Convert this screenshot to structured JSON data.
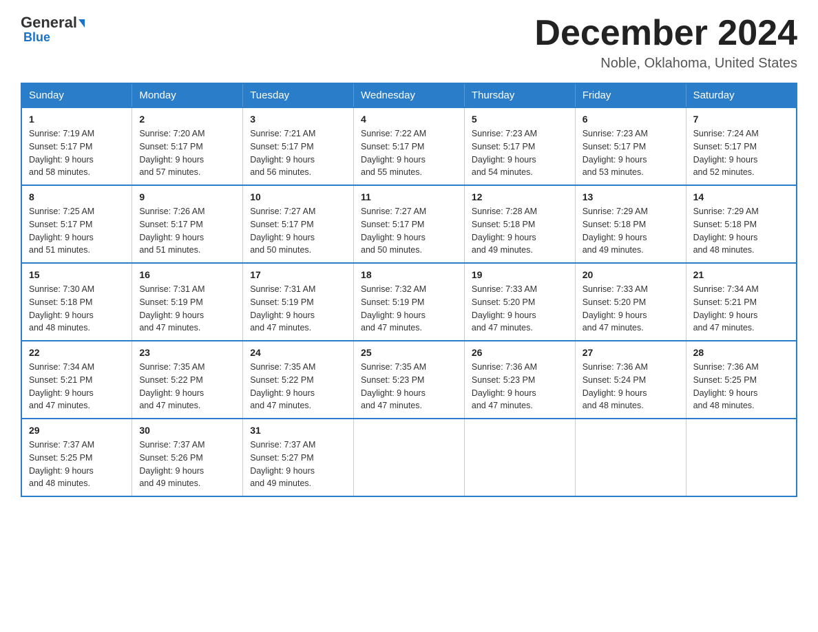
{
  "logo": {
    "general": "General",
    "arrow": "▶",
    "blue": "Blue"
  },
  "header": {
    "title": "December 2024",
    "subtitle": "Noble, Oklahoma, United States"
  },
  "weekdays": [
    "Sunday",
    "Monday",
    "Tuesday",
    "Wednesday",
    "Thursday",
    "Friday",
    "Saturday"
  ],
  "weeks": [
    [
      {
        "day": "1",
        "sunrise": "7:19 AM",
        "sunset": "5:17 PM",
        "daylight": "9 hours and 58 minutes."
      },
      {
        "day": "2",
        "sunrise": "7:20 AM",
        "sunset": "5:17 PM",
        "daylight": "9 hours and 57 minutes."
      },
      {
        "day": "3",
        "sunrise": "7:21 AM",
        "sunset": "5:17 PM",
        "daylight": "9 hours and 56 minutes."
      },
      {
        "day": "4",
        "sunrise": "7:22 AM",
        "sunset": "5:17 PM",
        "daylight": "9 hours and 55 minutes."
      },
      {
        "day": "5",
        "sunrise": "7:23 AM",
        "sunset": "5:17 PM",
        "daylight": "9 hours and 54 minutes."
      },
      {
        "day": "6",
        "sunrise": "7:23 AM",
        "sunset": "5:17 PM",
        "daylight": "9 hours and 53 minutes."
      },
      {
        "day": "7",
        "sunrise": "7:24 AM",
        "sunset": "5:17 PM",
        "daylight": "9 hours and 52 minutes."
      }
    ],
    [
      {
        "day": "8",
        "sunrise": "7:25 AM",
        "sunset": "5:17 PM",
        "daylight": "9 hours and 51 minutes."
      },
      {
        "day": "9",
        "sunrise": "7:26 AM",
        "sunset": "5:17 PM",
        "daylight": "9 hours and 51 minutes."
      },
      {
        "day": "10",
        "sunrise": "7:27 AM",
        "sunset": "5:17 PM",
        "daylight": "9 hours and 50 minutes."
      },
      {
        "day": "11",
        "sunrise": "7:27 AM",
        "sunset": "5:17 PM",
        "daylight": "9 hours and 50 minutes."
      },
      {
        "day": "12",
        "sunrise": "7:28 AM",
        "sunset": "5:18 PM",
        "daylight": "9 hours and 49 minutes."
      },
      {
        "day": "13",
        "sunrise": "7:29 AM",
        "sunset": "5:18 PM",
        "daylight": "9 hours and 49 minutes."
      },
      {
        "day": "14",
        "sunrise": "7:29 AM",
        "sunset": "5:18 PM",
        "daylight": "9 hours and 48 minutes."
      }
    ],
    [
      {
        "day": "15",
        "sunrise": "7:30 AM",
        "sunset": "5:18 PM",
        "daylight": "9 hours and 48 minutes."
      },
      {
        "day": "16",
        "sunrise": "7:31 AM",
        "sunset": "5:19 PM",
        "daylight": "9 hours and 47 minutes."
      },
      {
        "day": "17",
        "sunrise": "7:31 AM",
        "sunset": "5:19 PM",
        "daylight": "9 hours and 47 minutes."
      },
      {
        "day": "18",
        "sunrise": "7:32 AM",
        "sunset": "5:19 PM",
        "daylight": "9 hours and 47 minutes."
      },
      {
        "day": "19",
        "sunrise": "7:33 AM",
        "sunset": "5:20 PM",
        "daylight": "9 hours and 47 minutes."
      },
      {
        "day": "20",
        "sunrise": "7:33 AM",
        "sunset": "5:20 PM",
        "daylight": "9 hours and 47 minutes."
      },
      {
        "day": "21",
        "sunrise": "7:34 AM",
        "sunset": "5:21 PM",
        "daylight": "9 hours and 47 minutes."
      }
    ],
    [
      {
        "day": "22",
        "sunrise": "7:34 AM",
        "sunset": "5:21 PM",
        "daylight": "9 hours and 47 minutes."
      },
      {
        "day": "23",
        "sunrise": "7:35 AM",
        "sunset": "5:22 PM",
        "daylight": "9 hours and 47 minutes."
      },
      {
        "day": "24",
        "sunrise": "7:35 AM",
        "sunset": "5:22 PM",
        "daylight": "9 hours and 47 minutes."
      },
      {
        "day": "25",
        "sunrise": "7:35 AM",
        "sunset": "5:23 PM",
        "daylight": "9 hours and 47 minutes."
      },
      {
        "day": "26",
        "sunrise": "7:36 AM",
        "sunset": "5:23 PM",
        "daylight": "9 hours and 47 minutes."
      },
      {
        "day": "27",
        "sunrise": "7:36 AM",
        "sunset": "5:24 PM",
        "daylight": "9 hours and 48 minutes."
      },
      {
        "day": "28",
        "sunrise": "7:36 AM",
        "sunset": "5:25 PM",
        "daylight": "9 hours and 48 minutes."
      }
    ],
    [
      {
        "day": "29",
        "sunrise": "7:37 AM",
        "sunset": "5:25 PM",
        "daylight": "9 hours and 48 minutes."
      },
      {
        "day": "30",
        "sunrise": "7:37 AM",
        "sunset": "5:26 PM",
        "daylight": "9 hours and 49 minutes."
      },
      {
        "day": "31",
        "sunrise": "7:37 AM",
        "sunset": "5:27 PM",
        "daylight": "9 hours and 49 minutes."
      },
      null,
      null,
      null,
      null
    ]
  ]
}
